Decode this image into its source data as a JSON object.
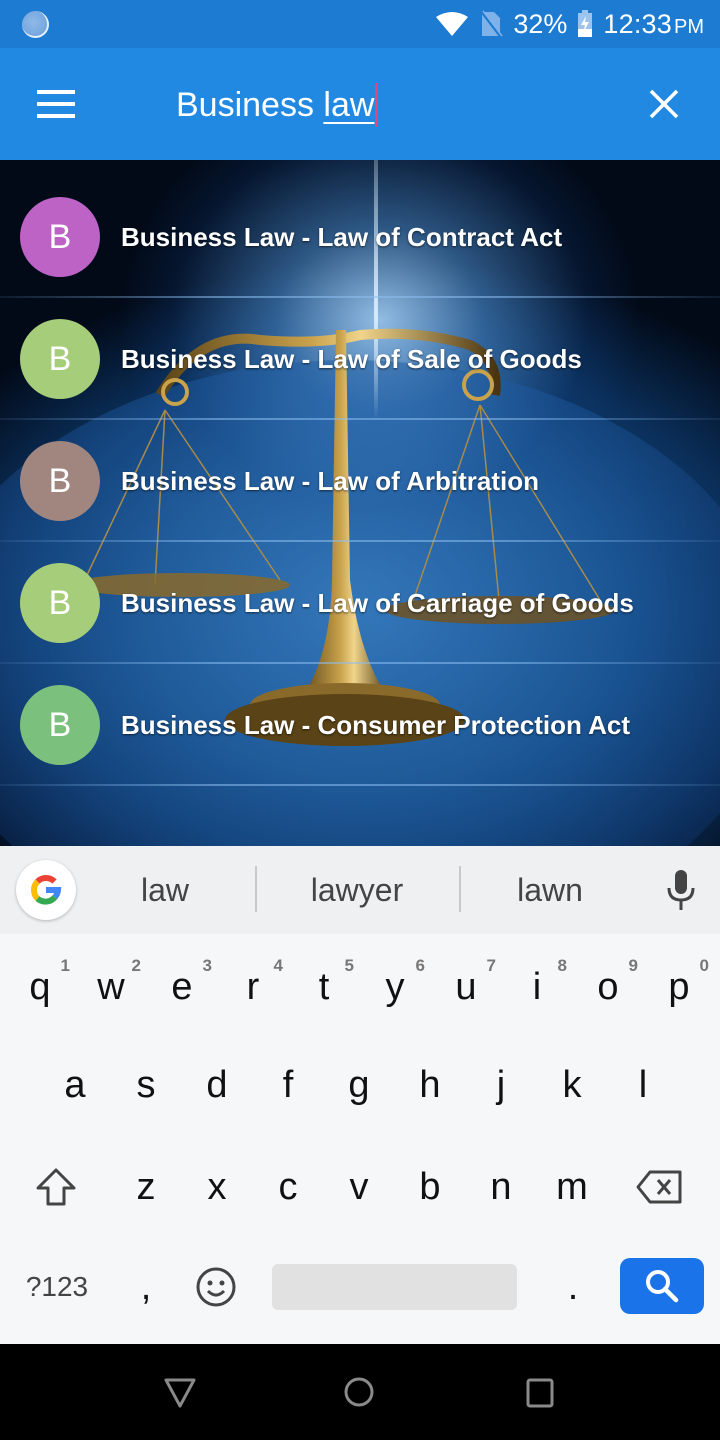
{
  "status_bar": {
    "sync_icon": "sync-circle-icon",
    "wifi_icon": "wifi-icon",
    "sim_icon": "no-sim-icon",
    "battery_percent": "32%",
    "battery_icon": "battery-charging-icon",
    "time": "12:33",
    "ampm": "PM"
  },
  "app_bar": {
    "menu_icon": "hamburger-menu-icon",
    "search_text_plain": "Business ",
    "search_text_composing": "law",
    "close_icon": "close-icon",
    "color": "#2289e3"
  },
  "results": [
    {
      "initial": "B",
      "title": "Business Law - Law of Contract Act",
      "avatar_color": "#be63c6"
    },
    {
      "initial": "B",
      "title": "Business Law - Law of Sale of Goods",
      "avatar_color": "#a6cd7a"
    },
    {
      "initial": "B",
      "title": "Business Law - Law of Arbitration",
      "avatar_color": "#a18680"
    },
    {
      "initial": "B",
      "title": "Business Law - Law of Carriage of Goods",
      "avatar_color": "#a6cd7a"
    },
    {
      "initial": "B",
      "title": "Business Law - Consumer Protection Act",
      "avatar_color": "#7cc07e"
    }
  ],
  "keyboard": {
    "google_icon": "google-g-icon",
    "suggestions": [
      "law",
      "lawyer",
      "lawn"
    ],
    "mic_icon": "microphone-icon",
    "row1": [
      {
        "key": "q",
        "hint": "1"
      },
      {
        "key": "w",
        "hint": "2"
      },
      {
        "key": "e",
        "hint": "3"
      },
      {
        "key": "r",
        "hint": "4"
      },
      {
        "key": "t",
        "hint": "5"
      },
      {
        "key": "y",
        "hint": "6"
      },
      {
        "key": "u",
        "hint": "7"
      },
      {
        "key": "i",
        "hint": "8"
      },
      {
        "key": "o",
        "hint": "9"
      },
      {
        "key": "p",
        "hint": "0"
      }
    ],
    "row2": [
      "a",
      "s",
      "d",
      "f",
      "g",
      "h",
      "j",
      "k",
      "l"
    ],
    "row3": [
      "z",
      "x",
      "c",
      "v",
      "b",
      "n",
      "m"
    ],
    "shift_icon": "shift-icon",
    "backspace_icon": "backspace-icon",
    "symbols_label": "?123",
    "comma": ",",
    "emoji_icon": "emoji-icon",
    "period": ".",
    "search_icon": "search-icon",
    "accent": "#1a73e8"
  },
  "nav_bar": {
    "back_icon": "back-triangle-icon",
    "home_icon": "home-circle-icon",
    "recents_icon": "recents-square-icon"
  }
}
